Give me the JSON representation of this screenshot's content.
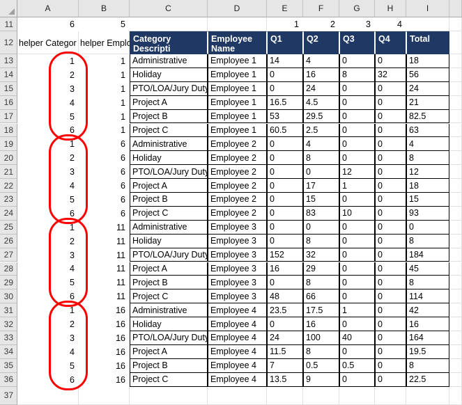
{
  "app": {
    "type": "spreadsheet"
  },
  "grid": {
    "column_headers": [
      "A",
      "B",
      "C",
      "D",
      "E",
      "F",
      "G",
      "H",
      "I"
    ],
    "row_headers": [
      "11",
      "12",
      "13",
      "14",
      "15",
      "16",
      "17",
      "18",
      "19",
      "20",
      "21",
      "22",
      "23",
      "24",
      "25",
      "26",
      "27",
      "28",
      "29",
      "30",
      "31",
      "32",
      "33",
      "34",
      "35",
      "36",
      "37"
    ],
    "select_all_icon": "select-all-triangle-icon"
  },
  "row11": {
    "a": "6",
    "b": "5",
    "e": "1",
    "f": "2",
    "g": "3",
    "h": "4"
  },
  "row12_helpers": {
    "a": "helper Categor",
    "b": "helper Employ"
  },
  "table": {
    "headers": [
      "Category Descripti",
      "Employee Name",
      "Q1",
      "Q2",
      "Q3",
      "Q4",
      "Total"
    ],
    "header_bg": "#1f3864",
    "header_fg": "#ffffff",
    "rows": [
      {
        "a": "1",
        "b": "1",
        "category": "Administrative",
        "employee": "Employee 1",
        "q1": "14",
        "q2": "4",
        "q3": "0",
        "q4": "0",
        "total": "18"
      },
      {
        "a": "2",
        "b": "1",
        "category": "Holiday",
        "employee": "Employee 1",
        "q1": "0",
        "q2": "16",
        "q3": "8",
        "q4": "32",
        "total": "56"
      },
      {
        "a": "3",
        "b": "1",
        "category": "PTO/LOA/Jury Duty",
        "employee": "Employee 1",
        "q1": "0",
        "q2": "24",
        "q3": "0",
        "q4": "0",
        "total": "24"
      },
      {
        "a": "4",
        "b": "1",
        "category": "Project A",
        "employee": "Employee 1",
        "q1": "16.5",
        "q2": "4.5",
        "q3": "0",
        "q4": "0",
        "total": "21"
      },
      {
        "a": "5",
        "b": "1",
        "category": "Project B",
        "employee": "Employee 1",
        "q1": "53",
        "q2": "29.5",
        "q3": "0",
        "q4": "0",
        "total": "82.5"
      },
      {
        "a": "6",
        "b": "1",
        "category": "Project C",
        "employee": "Employee 1",
        "q1": "60.5",
        "q2": "2.5",
        "q3": "0",
        "q4": "0",
        "total": "63"
      },
      {
        "a": "1",
        "b": "6",
        "category": "Administrative",
        "employee": "Employee 2",
        "q1": "0",
        "q2": "4",
        "q3": "0",
        "q4": "0",
        "total": "4"
      },
      {
        "a": "2",
        "b": "6",
        "category": "Holiday",
        "employee": "Employee 2",
        "q1": "0",
        "q2": "8",
        "q3": "0",
        "q4": "0",
        "total": "8"
      },
      {
        "a": "3",
        "b": "6",
        "category": "PTO/LOA/Jury Duty",
        "employee": "Employee 2",
        "q1": "0",
        "q2": "0",
        "q3": "12",
        "q4": "0",
        "total": "12"
      },
      {
        "a": "4",
        "b": "6",
        "category": "Project A",
        "employee": "Employee 2",
        "q1": "0",
        "q2": "17",
        "q3": "1",
        "q4": "0",
        "total": "18"
      },
      {
        "a": "5",
        "b": "6",
        "category": "Project B",
        "employee": "Employee 2",
        "q1": "0",
        "q2": "15",
        "q3": "0",
        "q4": "0",
        "total": "15"
      },
      {
        "a": "6",
        "b": "6",
        "category": "Project C",
        "employee": "Employee 2",
        "q1": "0",
        "q2": "83",
        "q3": "10",
        "q4": "0",
        "total": "93"
      },
      {
        "a": "1",
        "b": "11",
        "category": "Administrative",
        "employee": "Employee 3",
        "q1": "0",
        "q2": "0",
        "q3": "0",
        "q4": "0",
        "total": "0"
      },
      {
        "a": "2",
        "b": "11",
        "category": "Holiday",
        "employee": "Employee 3",
        "q1": "0",
        "q2": "8",
        "q3": "0",
        "q4": "0",
        "total": "8"
      },
      {
        "a": "3",
        "b": "11",
        "category": "PTO/LOA/Jury Duty",
        "employee": "Employee 3",
        "q1": "152",
        "q2": "32",
        "q3": "0",
        "q4": "0",
        "total": "184"
      },
      {
        "a": "4",
        "b": "11",
        "category": "Project A",
        "employee": "Employee 3",
        "q1": "16",
        "q2": "29",
        "q3": "0",
        "q4": "0",
        "total": "45"
      },
      {
        "a": "5",
        "b": "11",
        "category": "Project B",
        "employee": "Employee 3",
        "q1": "0",
        "q2": "8",
        "q3": "0",
        "q4": "0",
        "total": "8"
      },
      {
        "a": "6",
        "b": "11",
        "category": "Project C",
        "employee": "Employee 3",
        "q1": "48",
        "q2": "66",
        "q3": "0",
        "q4": "0",
        "total": "114"
      },
      {
        "a": "1",
        "b": "16",
        "category": "Administrative",
        "employee": "Employee 4",
        "q1": "23.5",
        "q2": "17.5",
        "q3": "1",
        "q4": "0",
        "total": "42"
      },
      {
        "a": "2",
        "b": "16",
        "category": "Holiday",
        "employee": "Employee 4",
        "q1": "0",
        "q2": "16",
        "q3": "0",
        "q4": "0",
        "total": "16"
      },
      {
        "a": "3",
        "b": "16",
        "category": "PTO/LOA/Jury Duty",
        "employee": "Employee 4",
        "q1": "24",
        "q2": "100",
        "q3": "40",
        "q4": "0",
        "total": "164"
      },
      {
        "a": "4",
        "b": "16",
        "category": "Project A",
        "employee": "Employee 4",
        "q1": "11.5",
        "q2": "8",
        "q3": "0",
        "q4": "0",
        "total": "19.5"
      },
      {
        "a": "5",
        "b": "16",
        "category": "Project B",
        "employee": "Employee 4",
        "q1": "7",
        "q2": "0.5",
        "q3": "0.5",
        "q4": "0",
        "total": "8"
      },
      {
        "a": "6",
        "b": "16",
        "category": "Project C",
        "employee": "Employee 4",
        "q1": "13.5",
        "q2": "9",
        "q3": "0",
        "q4": "0",
        "total": "22.5"
      }
    ]
  },
  "annotations": {
    "color": "#ff0000",
    "ovals": [
      {
        "label": "oval-block-1",
        "first_row": "13",
        "last_row": "18"
      },
      {
        "label": "oval-block-2",
        "first_row": "19",
        "last_row": "24"
      },
      {
        "label": "oval-block-3",
        "first_row": "25",
        "last_row": "30"
      },
      {
        "label": "oval-block-4",
        "first_row": "31",
        "last_row": "36"
      }
    ]
  }
}
